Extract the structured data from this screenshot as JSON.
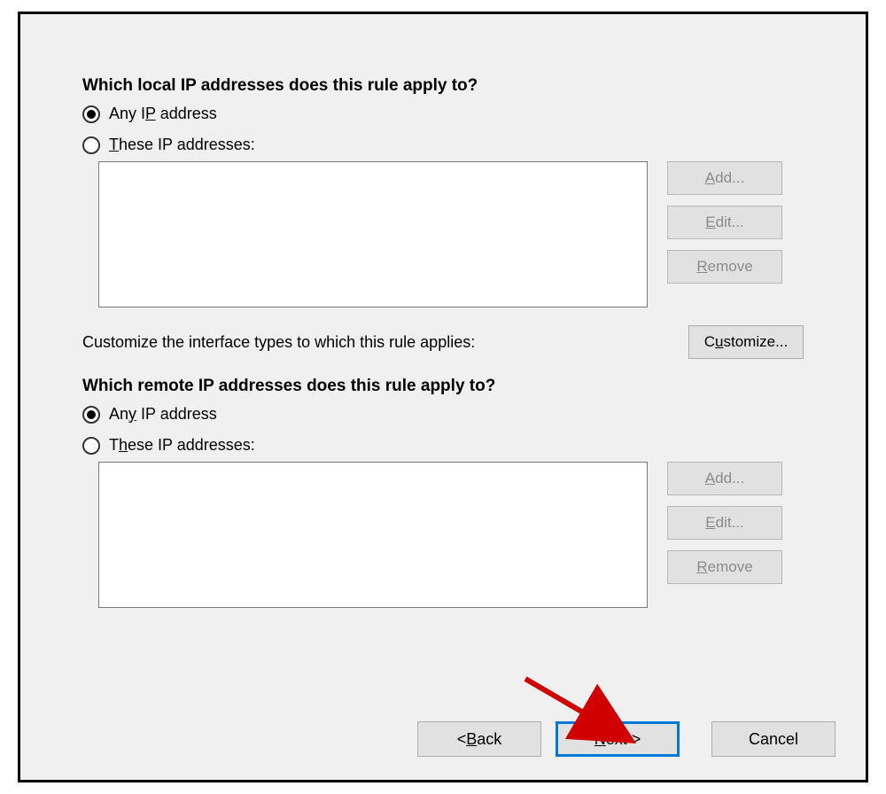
{
  "local": {
    "heading": "Which local IP addresses does this rule apply to?",
    "any_pre": "Any I",
    "any_ul": "P",
    "any_post": " address",
    "these_ul": "T",
    "these_post": "hese IP addresses:"
  },
  "remote": {
    "heading": "Which remote IP addresses does this rule apply to?",
    "any_pre": "An",
    "any_ul": "y",
    "any_post": " IP address",
    "these_pre": "T",
    "these_ul": "h",
    "these_post": "ese IP addresses:"
  },
  "customize": {
    "text": "Customize the interface types to which this rule applies:",
    "btn_pre": "C",
    "btn_ul": "u",
    "btn_post": "stomize..."
  },
  "buttons": {
    "add_ul": "A",
    "add_post": "dd...",
    "edit_ul": "E",
    "edit_post": "dit...",
    "remove_ul": "R",
    "remove_post": "emove"
  },
  "wizard": {
    "back_pre": "< ",
    "back_ul": "B",
    "back_post": "ack",
    "next_ul": "N",
    "next_post": "ext >",
    "cancel": "Cancel"
  }
}
